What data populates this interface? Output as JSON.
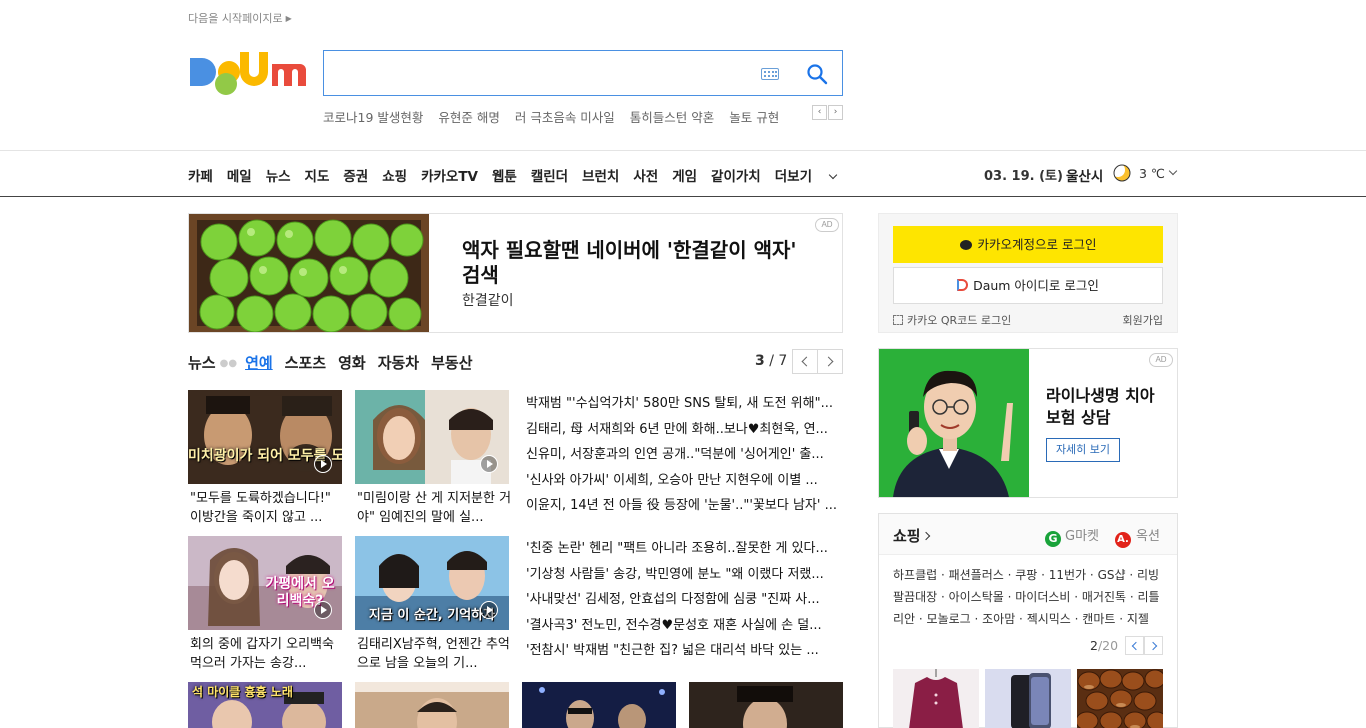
{
  "header": {
    "start_link": "다음을 시작페이지로",
    "search": {
      "placeholder": ""
    },
    "trending": [
      "코로나19 발생현황",
      "유현준 해명",
      "러 극초음속 미사일",
      "톰히들스턴 약혼",
      "놀토 규현"
    ]
  },
  "gnb": {
    "menu": [
      "카페",
      "메일",
      "뉴스",
      "지도",
      "증권",
      "쇼핑",
      "카카오TV",
      "웹툰",
      "캘린더",
      "브런치",
      "사전",
      "게임",
      "같이가치"
    ],
    "more": "더보기",
    "date": "03. 19. (토)",
    "city": "울산시",
    "temp": "3 ℃",
    "weather_icon": "crescent-moon-icon"
  },
  "main_ad": {
    "headline": "액자 필요할땐 네이버에 '한결같이 액자' 검색",
    "sub": "한결같이",
    "badge": "AD"
  },
  "news": {
    "tabs": [
      {
        "label": "뉴스",
        "active": false
      },
      {
        "label": "연예",
        "active": true
      },
      {
        "label": "스포츠",
        "active": false
      },
      {
        "label": "영화",
        "active": false
      },
      {
        "label": "자동차",
        "active": false
      },
      {
        "label": "부동산",
        "active": false
      }
    ],
    "page_current": "3",
    "page_sep": "/",
    "page_total": "7",
    "row1": {
      "thumb1_caption": "미치광이가 되어 모두를 도륙하겠습니다",
      "thumb1_title": "\"모두를 도륙하겠습니다!\" 이방간을 죽이지 않고 ...",
      "thumb2_title": "\"미림이랑 산 게 지저분한 거야\" 임예진의 말에 실...",
      "headlines": [
        "박재범 \"'수십억가치' 580만 SNS 탈퇴, 새 도전 위해\"...",
        "김태리, 母 서재희와 6년 만에 화해..보나♥최현욱, 연...",
        "신유미, 서장훈과의 인연 공개..\"덕분에 '싱어게인' 출...",
        "'신사와 아가씨' 이세희, 오승아 만난 지현우에 이별 ...",
        "이윤지, 14년 전 아들 役 등장에 '눈물'..\"'꽃보다 남자' ..."
      ]
    },
    "row2": {
      "thumb1_caption": "가평에서 오리백숙?",
      "thumb1_title": "회의 중에 갑자기 오리백숙 먹으러 가자는 송강...",
      "thumb2_caption": "지금 이 순간, 기억하자",
      "thumb2_title": "김태리X남주혁, 언젠간 추억으로 남을 오늘의 기...",
      "headlines": [
        "'친중 논란' 헨리 \"팩트 아니라 조용히..잘못한 게 있다...",
        "'기상청 사람들' 송강, 박민영에 분노 \"왜 이랬다 저랬...",
        "'사내맞선' 김세정, 안효섭의 다정함에 심쿵 \"진짜 사...",
        "'결사곡3' 전노민, 전수경♥문성호 재혼 사실에 손 덜...",
        "'전참시' 박재범 \"친근한 집? 넓은 대리석 바닥 있는 ..."
      ]
    },
    "row3_caption": "석 마이클 흉흉 노래"
  },
  "login": {
    "kakao": "카카오계정으로 로그인",
    "daum": "Daum 아이디로 로그인",
    "qr": "카카오 QR코드 로그인",
    "signup": "회원가입"
  },
  "side_ad": {
    "headline": "라이나생명 치아보험 상담",
    "cta": "자세히 보기",
    "badge": "AD"
  },
  "shopping": {
    "title": "쇼핑",
    "gmarket": "G마켓",
    "gmarket_logo": "G",
    "auction": "옥션",
    "auction_logo": "A.",
    "links": "하프클럽 · 패션플러스 · 쿠팡 · 11번가 · GS샵 · 리빙팔끔대장 · 아이스탁몰 · 마이더스비 · 매거진톡 · 리틀리안 · 모놀로그 · 조아맘 · 젝시믹스 · 캔마트 · 지젤",
    "page_current": "2",
    "page_total": "/20"
  },
  "colors": {
    "accent_blue": "#1a73e8",
    "kakao_yellow": "#fee500",
    "search_border": "#4a90e2"
  }
}
